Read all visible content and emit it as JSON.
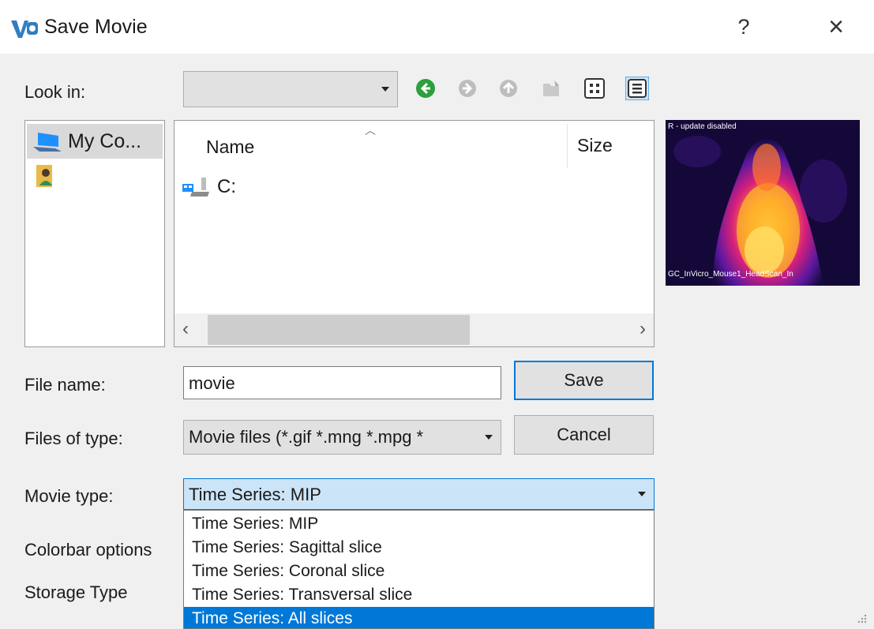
{
  "window": {
    "title": "Save Movie",
    "help_label": "?",
    "close_label": "×"
  },
  "look_in": {
    "label": "Look in:",
    "value": ""
  },
  "sidebar": {
    "items": [
      {
        "label": "My Co...",
        "icon": "computer-icon",
        "selected": true
      },
      {
        "label": "",
        "icon": "user-folder-icon",
        "selected": false
      }
    ]
  },
  "filelist": {
    "columns": [
      "Name",
      "Size"
    ],
    "rows": [
      {
        "name": "C:",
        "icon": "drive-icon"
      }
    ]
  },
  "preview": {
    "top_text": "R - update disabled",
    "bottom_text": "GC_InVicro_Mouse1_HeadScan_In"
  },
  "file_name": {
    "label": "File name:",
    "value": "movie"
  },
  "file_type": {
    "label": "Files of type:",
    "value": "Movie files (*.gif *.mng *.mpg *"
  },
  "movie_type": {
    "label": "Movie type:",
    "value": "Time Series: MIP",
    "options": [
      "Time Series: MIP",
      "Time Series: Sagittal slice",
      "Time Series: Coronal slice",
      "Time Series: Transversal slice",
      "Time Series: All slices"
    ],
    "highlighted_index": 4
  },
  "colorbar": {
    "label": "Colorbar options"
  },
  "storage": {
    "label": "Storage Type"
  },
  "buttons": {
    "save": "Save",
    "cancel": "Cancel"
  },
  "colors": {
    "accent": "#0078d7",
    "nav_green": "#2e9e3e",
    "selection_bg": "#cce4f7"
  }
}
